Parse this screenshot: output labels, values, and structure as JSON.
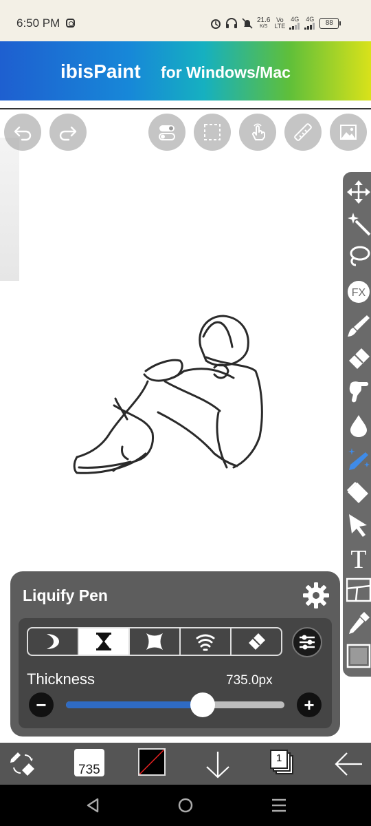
{
  "status_bar": {
    "time": "6:50 PM",
    "speed_value": "21.6",
    "speed_unit": "K/S",
    "volte_top": "Vo",
    "volte_bottom": "LTE",
    "net1": "4G",
    "net2": "4G",
    "battery": "88"
  },
  "ad_banner": {
    "logo_text": "ibisPaint",
    "tagline": "for Windows/Mac"
  },
  "top_toolbar": {
    "buttons": [
      "undo",
      "redo",
      "toggle",
      "selection",
      "touch",
      "ruler",
      "reference-image"
    ]
  },
  "right_tools": [
    "transform",
    "magic-wand",
    "lasso",
    "filter",
    "brush",
    "eraser",
    "smudge",
    "blur",
    "special-pen",
    "fill",
    "selection-pen",
    "text",
    "frame-divider",
    "eyedropper",
    "canvas"
  ],
  "right_tools_fx_label": "FX",
  "right_tools_text_label": "T",
  "liquify_panel": {
    "title": "Liquify Pen",
    "modes": [
      "push",
      "pinch",
      "expand",
      "twirl",
      "restore"
    ],
    "active_mode": "pinch",
    "thickness_label": "Thickness",
    "thickness_value": "735.0px",
    "thickness_fraction": 0.625
  },
  "bottom_toolbar": {
    "brush_size": "735",
    "layer_count": "1",
    "color": "#000000"
  },
  "colors": {
    "panel_bg": "#5d5d5d",
    "slider_fill": "#2f6bc3",
    "toolbar_bg": "#555555"
  }
}
